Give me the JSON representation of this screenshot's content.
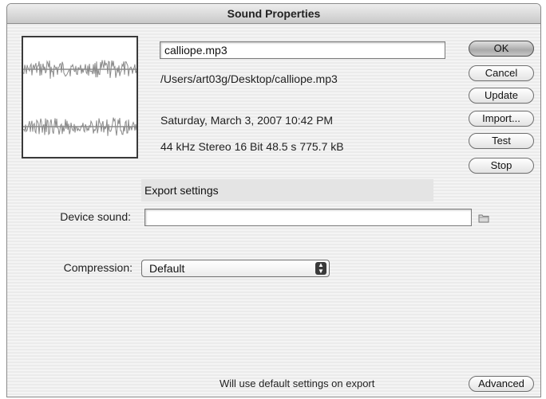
{
  "window": {
    "title": "Sound Properties"
  },
  "sound": {
    "name": "calliope.mp3",
    "path": "/Users/art03g/Desktop/calliope.mp3",
    "date": "Saturday, March 3, 2007  10:42 PM",
    "format": "44 kHz Stereo 16 Bit 48.5 s 775.7 kB"
  },
  "buttons": {
    "ok": "OK",
    "cancel": "Cancel",
    "update": "Update",
    "import": "Import...",
    "test": "Test",
    "stop": "Stop",
    "advanced": "Advanced"
  },
  "export": {
    "header": "Export settings",
    "device_sound_label": "Device sound:",
    "device_sound_value": "",
    "compression_label": "Compression:",
    "compression_value": "Default",
    "status": "Will use default settings on export"
  },
  "icons": {
    "browse": "folder-icon",
    "select": "updown-arrows-icon"
  }
}
